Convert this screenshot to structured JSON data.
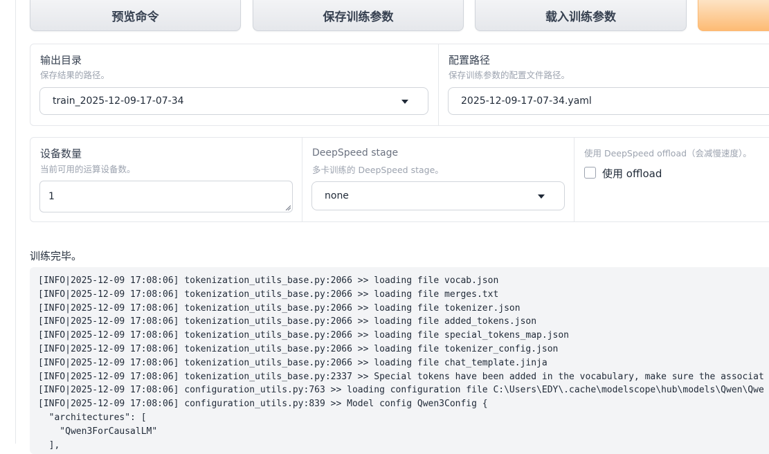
{
  "toolbar": {
    "preview_label": "预览命令",
    "save_label": "保存训练参数",
    "load_label": "载入训练参数"
  },
  "output_dir": {
    "label": "输出目录",
    "info": "保存结果的路径。",
    "value": "train_2025-12-09-17-07-34"
  },
  "config_path": {
    "label": "配置路径",
    "info": "保存训练参数的配置文件路径。",
    "value": "2025-12-09-17-07-34.yaml"
  },
  "device_count": {
    "label": "设备数量",
    "info": "当前可用的运算设备数。",
    "value": "1"
  },
  "ds_stage": {
    "label": "DeepSpeed stage",
    "info": "多卡训练的 DeepSpeed stage。",
    "value": "none"
  },
  "ds_offload": {
    "label": "使用 DeepSpeed offload（会减慢速度）。",
    "checkbox_label": "使用 offload",
    "checked": false
  },
  "status": {
    "text": "训练完毕。"
  },
  "log": {
    "text": "[INFO|2025-12-09 17:08:06] tokenization_utils_base.py:2066 >> loading file vocab.json\n[INFO|2025-12-09 17:08:06] tokenization_utils_base.py:2066 >> loading file merges.txt\n[INFO|2025-12-09 17:08:06] tokenization_utils_base.py:2066 >> loading file tokenizer.json\n[INFO|2025-12-09 17:08:06] tokenization_utils_base.py:2066 >> loading file added_tokens.json\n[INFO|2025-12-09 17:08:06] tokenization_utils_base.py:2066 >> loading file special_tokens_map.json\n[INFO|2025-12-09 17:08:06] tokenization_utils_base.py:2066 >> loading file tokenizer_config.json\n[INFO|2025-12-09 17:08:06] tokenization_utils_base.py:2066 >> loading file chat_template.jinja\n[INFO|2025-12-09 17:08:06] tokenization_utils_base.py:2337 >> Special tokens have been added in the vocabulary, make sure the associat\n[INFO|2025-12-09 17:08:06] configuration_utils.py:763 >> loading configuration file C:\\Users\\EDY\\.cache\\modelscope\\hub\\models\\Qwen\\Qwe\n[INFO|2025-12-09 17:08:06] configuration_utils.py:839 >> Model config Qwen3Config {\n  \"architectures\": [\n    \"Qwen3ForCausalLM\"\n  ],"
  }
}
